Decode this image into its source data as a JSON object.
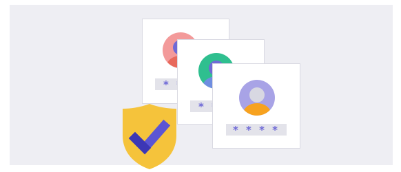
{
  "illustration": {
    "cards": [
      {
        "avatar_icon": "user-avatar-icon",
        "password_mask": "* * * *",
        "avatar_colors": {
          "background": "#f39a9a",
          "head": "#6f6ad6",
          "body": "#e86a5c"
        }
      },
      {
        "avatar_icon": "user-avatar-icon",
        "password_mask": "* * * *",
        "avatar_colors": {
          "background": "#2fbf8f",
          "head": "#6f6ad6",
          "body": "#6f8ee0"
        }
      },
      {
        "avatar_icon": "user-avatar-icon",
        "password_mask": "* * * *",
        "avatar_colors": {
          "background": "#a8a3e6",
          "head": "#d8d8e2",
          "body": "#f7a21f"
        }
      }
    ],
    "badge": {
      "icon": "shield-check-icon",
      "shield_color": "#f5c33b",
      "check_color": "#5b55d4"
    },
    "background_color": "#eeeef3"
  }
}
